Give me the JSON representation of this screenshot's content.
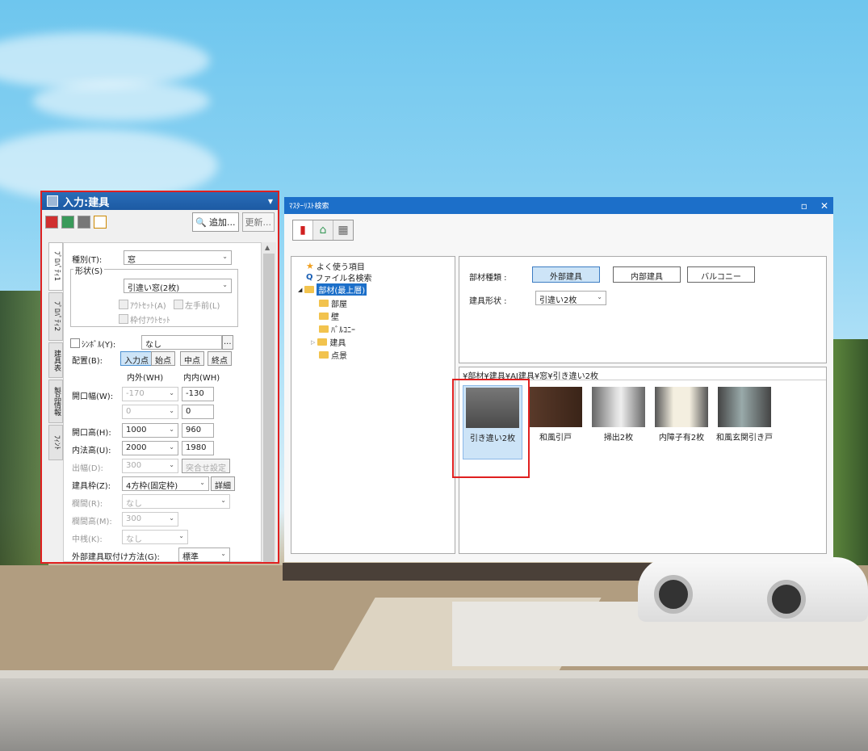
{
  "input_panel": {
    "title": "入力:建具",
    "toolbar": {
      "add_label": "追加...",
      "update_label": "更新..."
    },
    "tabs": [
      "ﾌﾟﾛﾊﾟﾃｨ1",
      "ﾌﾟﾛﾊﾟﾃｨ2",
      "建具表",
      "製品情報",
      "ﾌｨﾝﾄ"
    ],
    "fields": {
      "type_label": "種別(T):",
      "type_value": "窓",
      "shape_group": "形状(S)",
      "shape_value": "引違い窓(2枚)",
      "outset_label": "ｱｳﾄｾｯﾄ(A)",
      "left_front_label": "左手前(L)",
      "frame_outset_label": "枠付ｱｳﾄｾｯﾄ",
      "symbol_label": "ｼﾝﾎﾞﾙ(Y):",
      "symbol_value": "なし",
      "symbol_btn": "...",
      "place_label": "配置(B):",
      "place_options": [
        "入力点",
        "始点",
        "中点",
        "終点"
      ],
      "col_outer": "内外(WH)",
      "col_inner": "内内(WH)",
      "open_width_label": "開口幅(W):",
      "open_width_outer": "-170",
      "open_width_inner": "-130",
      "row2_outer": "0",
      "row2_inner": "0",
      "open_height_label": "開口高(H):",
      "open_height_outer": "1000",
      "open_height_inner": "960",
      "inner_height_label": "内法高(U):",
      "inner_height_outer": "2000",
      "inner_height_inner": "1980",
      "out_width_label": "出幅(D):",
      "out_width_value": "300",
      "fit_btn": "突合せ設定",
      "frame_label": "建具枠(Z):",
      "frame_value": "4方枠(固定枠)",
      "detail_btn": "詳細",
      "transom_label": "欄間(R):",
      "transom_value": "なし",
      "transom_height_label": "欄間高(M):",
      "transom_height_value": "300",
      "mullion_label": "中桟(K):",
      "mullion_value": "なし",
      "mount_label": "外部建具取付け方法(G):",
      "mount_value": "標準"
    }
  },
  "master_window": {
    "title": "ﾏｽﾀｰﾘｽﾄ検索",
    "tree": [
      {
        "label": "よく使う項目",
        "icon": "star-icon"
      },
      {
        "label": "ファイル名検索",
        "icon": "search-icon"
      },
      {
        "label": "部材(最上層)",
        "icon": "folder-icon",
        "selected": true
      },
      {
        "label": "部屋",
        "icon": "folder-icon"
      },
      {
        "label": "壁",
        "icon": "folder-icon"
      },
      {
        "label": "ﾊﾞﾙｺﾆｰ",
        "icon": "folder-icon"
      },
      {
        "label": "建具",
        "icon": "folder-icon"
      },
      {
        "label": "点景",
        "icon": "folder-icon"
      }
    ],
    "filter": {
      "kind_label": "部材種類 :",
      "kind_buttons": [
        "外部建具",
        "内部建具",
        "バルコニー"
      ],
      "shape_label": "建具形状 :",
      "shape_value": "引違い2枚"
    },
    "path": "¥部材¥建具¥AI建具¥窓¥引き違い2枚",
    "items": [
      {
        "caption": "引き違い2枚",
        "selected": true
      },
      {
        "caption": "和風引戸"
      },
      {
        "caption": "掃出2枚"
      },
      {
        "caption": "内障子有2枚"
      },
      {
        "caption": "和風玄関引き戸"
      }
    ]
  },
  "colors": {
    "title_blue": "#1c6fc9",
    "highlight_red": "#e02020",
    "selected_bg": "#cde4f7"
  }
}
